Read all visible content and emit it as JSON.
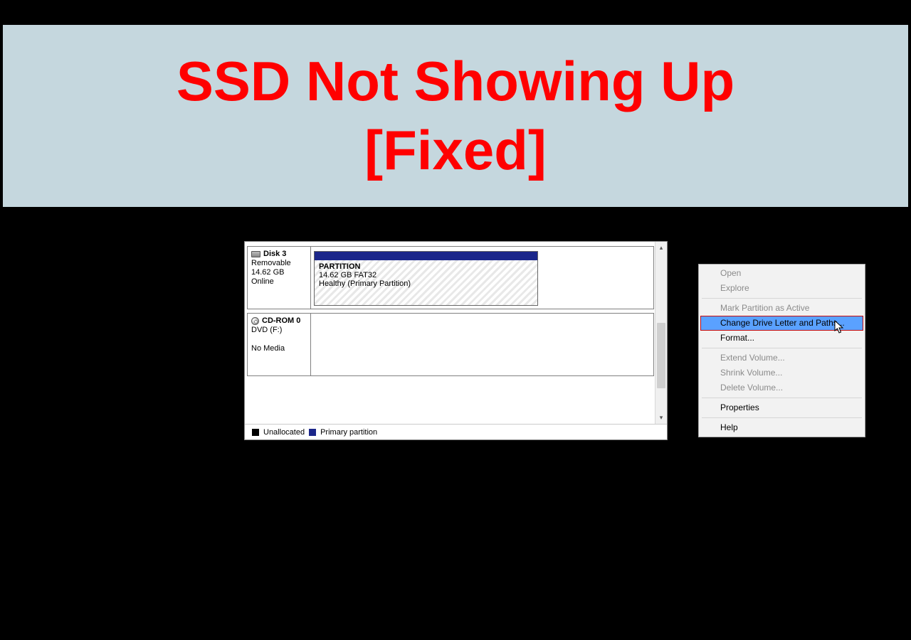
{
  "banner": {
    "title": "SSD Not Showing Up\n[Fixed]"
  },
  "disk3": {
    "name": "Disk 3",
    "type": "Removable",
    "size": "14.62 GB",
    "status": "Online"
  },
  "partition": {
    "name": "PARTITION",
    "details": "14.62 GB FAT32",
    "health": "Healthy (Primary Partition)"
  },
  "cdrom": {
    "name": "CD-ROM 0",
    "drive": "DVD (F:)",
    "status": "No Media"
  },
  "legend": {
    "unallocated": "Unallocated",
    "primary": "Primary partition"
  },
  "menu": {
    "open": "Open",
    "explore": "Explore",
    "mark_active": "Mark Partition as Active",
    "change_letter": "Change Drive Letter and Paths...",
    "format": "Format...",
    "extend": "Extend Volume...",
    "shrink": "Shrink Volume...",
    "delete": "Delete Volume...",
    "properties": "Properties",
    "help": "Help"
  }
}
